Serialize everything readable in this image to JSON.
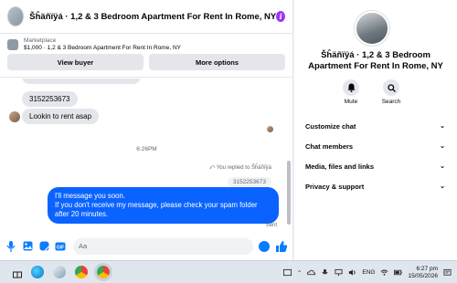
{
  "chat": {
    "title": "Šĥäñïÿá · 1,2 & 3 Bedroom Apartment For Rent In Rome, NY",
    "listing_label": "Marketplace",
    "listing_name": "$1,000 · 1,2 & 3 Bedroom Apartment For Rent In Rome, NY",
    "view_buyer": "View buyer",
    "more_options": "More options"
  },
  "messages": {
    "phone": "3152253673",
    "rent": "Lookin to rent asap",
    "time": "6:26PM",
    "replied": "You replied to Šĥäñïÿá",
    "quoted": "3152253673",
    "reply_line1": "I'll message you soon.",
    "reply_line2": "If you don't receive my message, please check your spam folder after 20 minutes.",
    "sent": "Sent"
  },
  "composer": {
    "placeholder": "Aa"
  },
  "profile": {
    "name": "Šĥäñïÿá · 1,2 & 3 Bedroom Apartment For Rent In Rome, NY",
    "mute": "Mute",
    "search": "Search",
    "menu": [
      "Customize chat",
      "Chat members",
      "Media, files and links",
      "Privacy & support"
    ]
  },
  "taskbar": {
    "lang": "ENG",
    "time": "6:27 pm",
    "date": "15/05/2026"
  },
  "colors": {
    "accent": "#0a63ff",
    "info": "#a033ff"
  }
}
